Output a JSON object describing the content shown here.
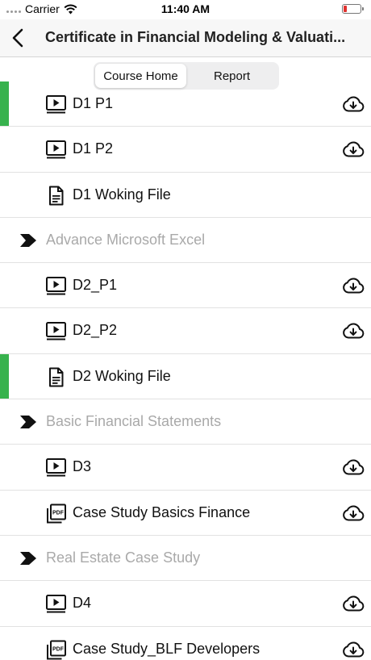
{
  "status_bar": {
    "carrier": "Carrier",
    "time": "11:40 AM"
  },
  "nav": {
    "title": "Certificate in Financial Modeling & Valuati..."
  },
  "segments": {
    "course_home": "Course Home",
    "report": "Report",
    "selected": "Course Home"
  },
  "colors": {
    "accent_green": "#37b24d",
    "section_gray": "#a9a9a9",
    "battery_red": "#e0322f"
  },
  "rows": [
    {
      "kind": "item",
      "icon": "video-icon",
      "label": "D1 P1",
      "download": true,
      "highlighted": true
    },
    {
      "kind": "item",
      "icon": "video-icon",
      "label": "D1 P2",
      "download": true,
      "highlighted": false
    },
    {
      "kind": "item",
      "icon": "document-icon",
      "label": "D1 Woking File",
      "download": false,
      "highlighted": false
    },
    {
      "kind": "section",
      "label": "Advance Microsoft Excel"
    },
    {
      "kind": "item",
      "icon": "video-icon",
      "label": "D2_P1",
      "download": true,
      "highlighted": false
    },
    {
      "kind": "item",
      "icon": "video-icon",
      "label": "D2_P2",
      "download": true,
      "highlighted": false
    },
    {
      "kind": "item",
      "icon": "document-icon",
      "label": "D2 Woking File",
      "download": false,
      "highlighted": true
    },
    {
      "kind": "section",
      "label": "Basic Financial Statements"
    },
    {
      "kind": "item",
      "icon": "video-icon",
      "label": "D3",
      "download": true,
      "highlighted": false
    },
    {
      "kind": "item",
      "icon": "pdf-icon",
      "label": "Case Study Basics Finance",
      "download": true,
      "highlighted": false
    },
    {
      "kind": "section",
      "label": "Real Estate Case Study"
    },
    {
      "kind": "item",
      "icon": "video-icon",
      "label": "D4",
      "download": true,
      "highlighted": false
    },
    {
      "kind": "item",
      "icon": "pdf-icon",
      "label": "Case Study_BLF Developers",
      "download": true,
      "highlighted": false
    }
  ]
}
